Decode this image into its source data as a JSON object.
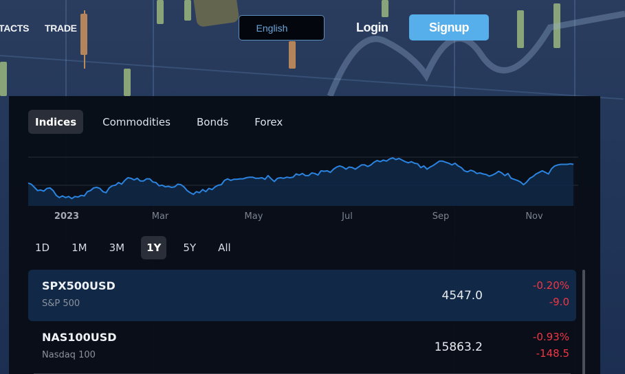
{
  "header": {
    "nav_links": [
      "TACTS",
      "TRADE"
    ],
    "language_select": {
      "value": "English"
    },
    "login_label": "Login",
    "signup_label": "Signup",
    "colors": {
      "signup_bg": "#56aeea",
      "language_text": "#6aa7dc"
    }
  },
  "widget": {
    "tabs": [
      {
        "label": "Indices",
        "active": true
      },
      {
        "label": "Commodities",
        "active": false
      },
      {
        "label": "Bonds",
        "active": false
      },
      {
        "label": "Forex",
        "active": false
      }
    ],
    "ranges": [
      {
        "label": "1D",
        "active": false
      },
      {
        "label": "1M",
        "active": false
      },
      {
        "label": "3M",
        "active": false
      },
      {
        "label": "1Y",
        "active": true
      },
      {
        "label": "5Y",
        "active": false
      },
      {
        "label": "All",
        "active": false
      }
    ],
    "symbols": [
      {
        "symbol": "SPX500USD",
        "name": "S&P 500",
        "price": "4547.0",
        "change_pct": "-0.20%",
        "change": "-9.0",
        "selected": true
      },
      {
        "symbol": "NAS100USD",
        "name": "Nasdaq 100",
        "price": "15863.2",
        "change_pct": "-0.93%",
        "change": "-148.5",
        "selected": false
      }
    ],
    "colors": {
      "line": "#2a84e0",
      "negative": "#f23645",
      "area": "#0f2846"
    }
  },
  "chart_data": {
    "type": "area",
    "title": "",
    "xlabel": "",
    "ylabel": "",
    "series_name": "SPX500USD (1Y)",
    "y_units": "relative level (no axis labels shown)",
    "ylim": [
      0,
      100
    ],
    "grid": true,
    "x_tick_labels": [
      {
        "label": "2023",
        "pos": 0.07,
        "emphasis": true
      },
      {
        "label": "Mar",
        "pos": 0.24
      },
      {
        "label": "May",
        "pos": 0.41
      },
      {
        "label": "Jul",
        "pos": 0.58
      },
      {
        "label": "Sep",
        "pos": 0.75
      },
      {
        "label": "Nov",
        "pos": 0.92
      }
    ],
    "values": [
      40,
      38,
      32,
      26,
      27,
      25,
      30,
      31,
      26,
      17,
      13,
      16,
      13,
      15,
      11,
      15,
      14,
      17,
      16,
      24,
      26,
      31,
      32,
      30,
      24,
      22,
      31,
      35,
      36,
      41,
      38,
      45,
      50,
      49,
      46,
      49,
      44,
      44,
      48,
      48,
      42,
      41,
      35,
      36,
      33,
      34,
      32,
      33,
      38,
      37,
      33,
      26,
      22,
      19,
      24,
      22,
      28,
      24,
      30,
      28,
      33,
      36,
      37,
      45,
      48,
      45,
      47,
      47,
      48,
      48,
      50,
      51,
      51,
      49,
      49,
      50,
      47,
      54,
      48,
      43,
      49,
      50,
      49,
      51,
      50,
      51,
      57,
      55,
      58,
      54,
      54,
      59,
      58,
      55,
      63,
      62,
      63,
      60,
      66,
      70,
      72,
      70,
      66,
      70,
      69,
      66,
      70,
      74,
      74,
      71,
      74,
      79,
      82,
      80,
      83,
      81,
      85,
      87,
      84,
      86,
      83,
      80,
      78,
      80,
      77,
      76,
      69,
      72,
      66,
      70,
      73,
      77,
      81,
      81,
      79,
      77,
      74,
      77,
      72,
      69,
      63,
      61,
      64,
      62,
      58,
      59,
      57,
      56,
      53,
      55,
      58,
      62,
      59,
      54,
      58,
      49,
      47,
      45,
      42,
      37,
      42,
      49,
      52,
      57,
      60,
      63,
      60,
      57,
      67,
      72,
      74,
      75,
      75,
      75,
      76,
      75
    ]
  }
}
